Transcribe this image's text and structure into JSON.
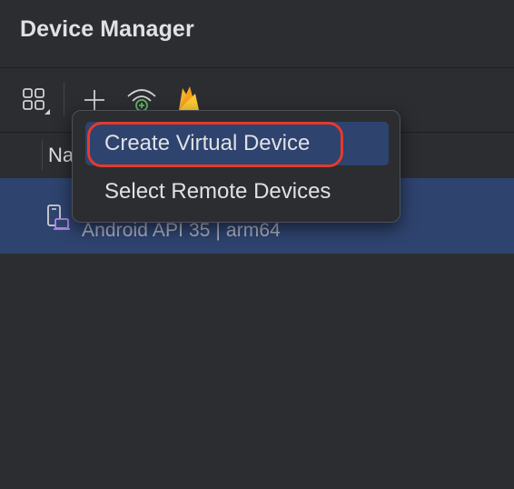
{
  "panel": {
    "title": "Device Manager"
  },
  "toolbar": {
    "icons": [
      "device-grid-icon",
      "add-icon",
      "wifi-pairing-icon",
      "firebase-icon"
    ]
  },
  "table": {
    "header_name": "Na",
    "rows": [
      {
        "subtitle": "Android API 35 | arm64",
        "icon": "virtual-device-icon",
        "selected": true
      }
    ]
  },
  "menu": {
    "items": [
      {
        "label": "Create Virtual Device",
        "selected": true
      },
      {
        "label": "Select Remote Devices",
        "selected": false
      }
    ]
  },
  "colors": {
    "background": "#2b2d30",
    "selection": "#2e436e",
    "highlight_ring": "#e53a2c",
    "firebase": "#f5b22d",
    "device_icon": "#b18ae6"
  }
}
